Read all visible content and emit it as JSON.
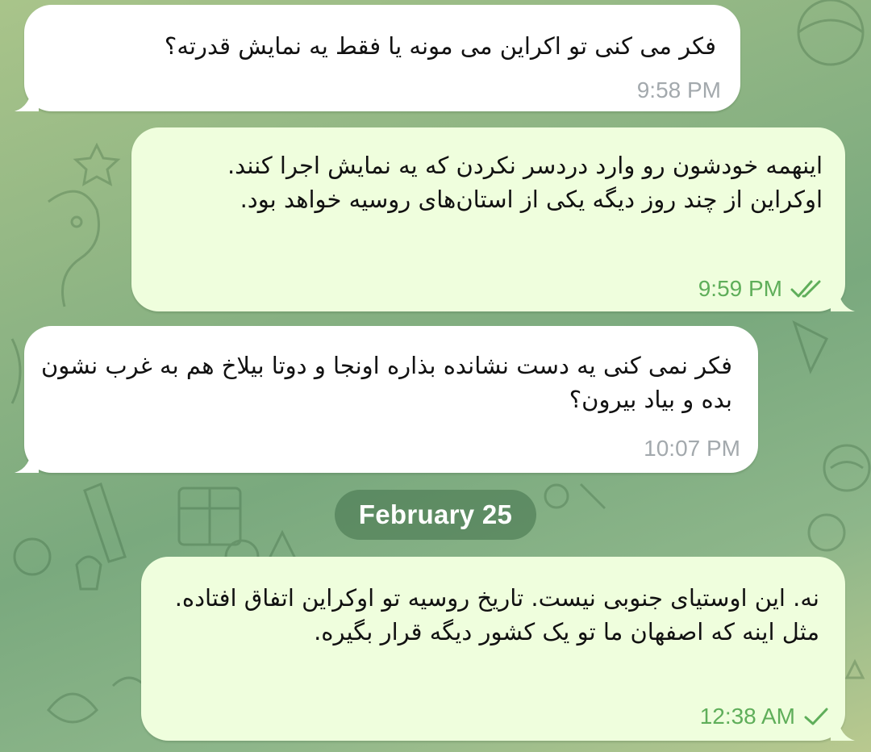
{
  "chat": {
    "messages": [
      {
        "direction": "incoming",
        "text": "فکر می کنی تو اکراین می مونه یا فقط یه نمایش قدرته؟",
        "time": "9:58 PM"
      },
      {
        "direction": "outgoing",
        "text": "اینهمه خودشون رو وارد دردسر نکردن که یه نمایش اجرا کنند. اوکراین از چند روز دیگه یکی از استان‌های روسیه خواهد بود.",
        "time": "9:59 PM",
        "status": "read",
        "status_icon": "double-check-icon"
      },
      {
        "direction": "incoming",
        "text": "فکر نمی کنی یه دست نشانده بذاره اونجا و دوتا بیلاخ هم به غرب نشون بده و بیاد بیرون؟",
        "time": "10:07 PM"
      },
      {
        "direction": "outgoing",
        "text": "نه. این اوستیای جنوبی نیست. تاریخ روسیه تو اوکراین اتفاق افتاده. مثل اینه که اصفهان ما تو یک کشور دیگه قرار بگیره.",
        "time": "12:38 AM",
        "status": "sent",
        "status_icon": "single-check-icon"
      }
    ],
    "date_separator": "February 25"
  },
  "colors": {
    "incoming_bubble": "#ffffff",
    "outgoing_bubble": "#effedd",
    "outgoing_meta": "#5fae5a",
    "incoming_meta": "#a3a9ad",
    "wallpaper": "#8fb584"
  }
}
